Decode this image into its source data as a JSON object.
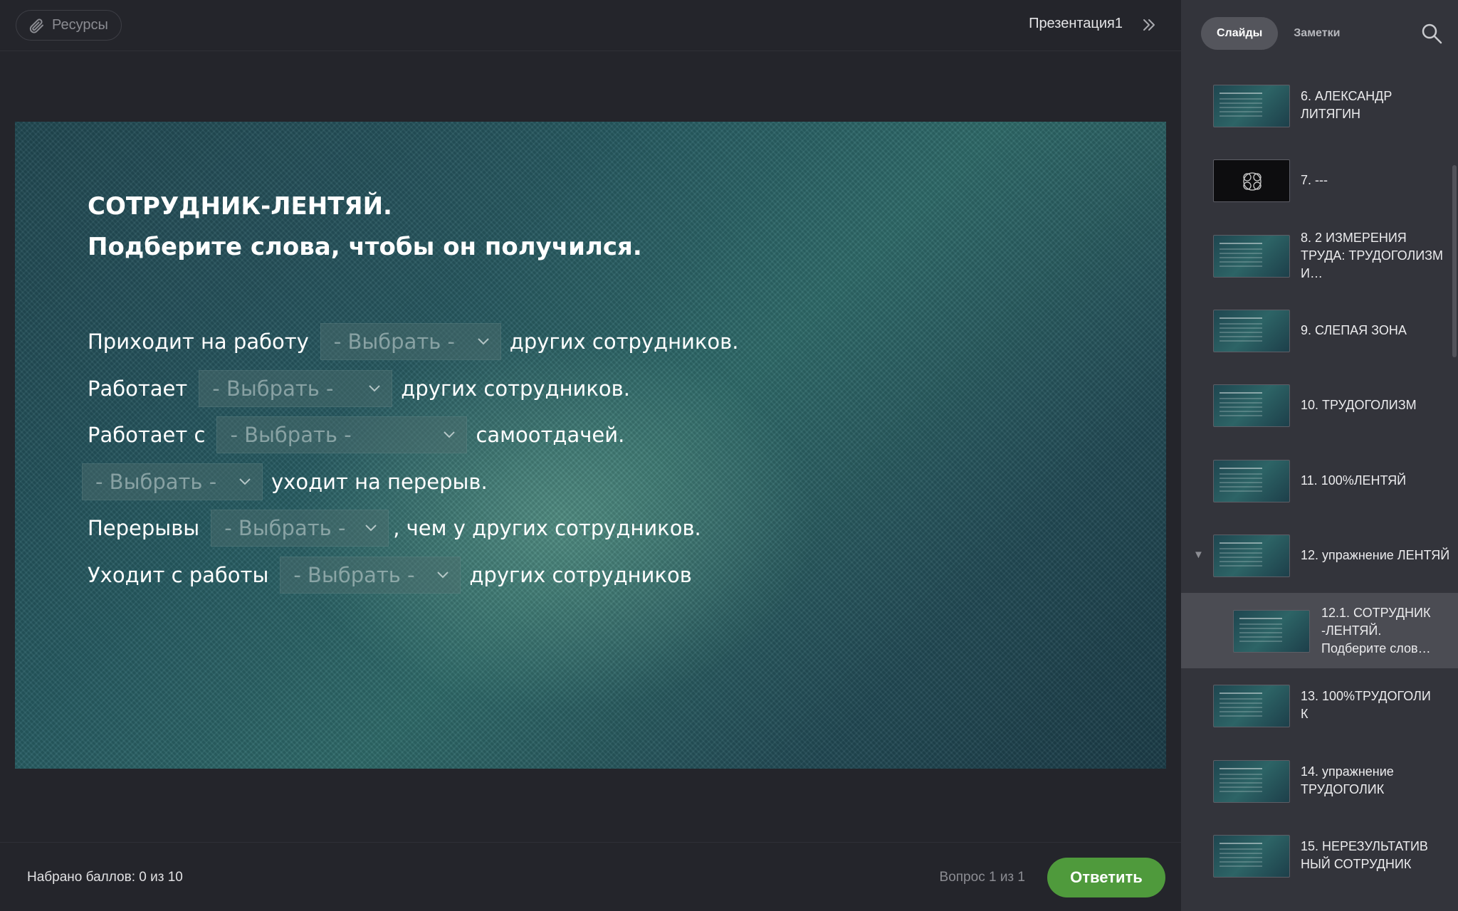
{
  "topbar": {
    "resources_label": "Ресурсы",
    "presentation_title": "Презентация1"
  },
  "slide": {
    "title_line1": "СОТРУДНИК-ЛЕНТЯЙ.",
    "title_line2": "Подберите слова, чтобы он получился.",
    "dropdown_placeholder": "- Выбрать -",
    "lines": [
      {
        "before": "Приходит на работу",
        "after": "других сотрудников."
      },
      {
        "before": "Работает",
        "after": "других сотрудников."
      },
      {
        "before": "Работает с",
        "after": "самоотдачей."
      },
      {
        "before": "",
        "after": "уходит на перерыв."
      },
      {
        "before": "Перерывы",
        "after": ", чем у других сотрудников."
      },
      {
        "before": "Уходит с работы",
        "after": "других сотрудников"
      }
    ]
  },
  "bottombar": {
    "score": "Набрано баллов: 0 из 10",
    "question_counter": "Вопрос 1 из 1",
    "submit_label": "Ответить",
    "submit_color": "#4f9a3c"
  },
  "sidebar": {
    "tabs": [
      {
        "label": "Слайды",
        "active": true
      },
      {
        "label": "Заметки",
        "active": false
      }
    ],
    "items": [
      {
        "label": "6. АЛЕКСАНДР ЛИТЯГИН"
      },
      {
        "label": "7. ---"
      },
      {
        "label": "8. 2 ИЗМЕРЕНИЯ ТРУДА: ТРУДОГОЛИЗМ И…"
      },
      {
        "label": "9. СЛЕПАЯ ЗОНА"
      },
      {
        "label": "10. ТРУДОГОЛИЗМ"
      },
      {
        "label": "11. 100%ЛЕНТЯЙ"
      },
      {
        "label": "12. упражнение ЛЕНТЯЙ"
      },
      {
        "label": "12.1. СОТРУДНИК-ЛЕНТЯЙ. Подберите слов…",
        "label_lines": [
          "12.1. СОТРУДНИК",
          "-ЛЕНТЯЙ.",
          "Подберите слов…"
        ]
      },
      {
        "label": "13. 100%ТРУДОГОЛИК",
        "label_lines": [
          "13. 100%ТРУДОГОЛИ",
          "К"
        ]
      },
      {
        "label": "14. упражнение ТРУДОГОЛИК"
      },
      {
        "label": "15. НЕРЕЗУЛЬТАТИВНЫЙ СОТРУДНИК",
        "label_lines": [
          "15. НЕРЕЗУЛЬТАТИВ",
          "НЫЙ СОТРУДНИК"
        ]
      }
    ]
  }
}
